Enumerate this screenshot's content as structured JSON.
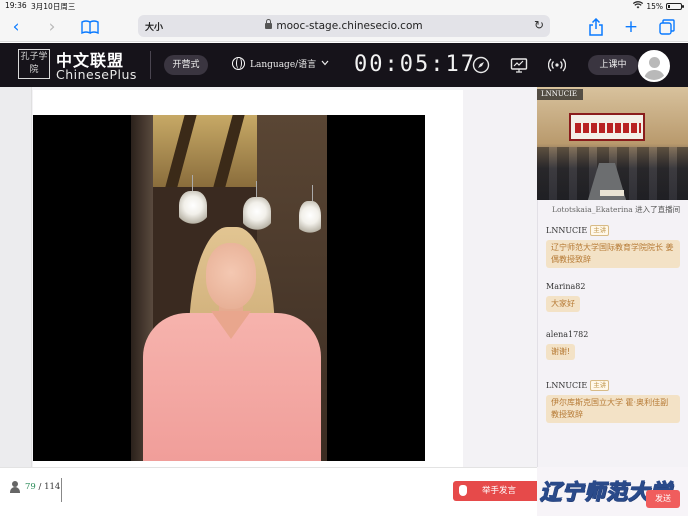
{
  "status_bar": {
    "time": "19:36",
    "date": "3月10日周三",
    "battery": "15%",
    "battery_level": 0.15
  },
  "browser": {
    "text_size": "大小",
    "url": "mooc-stage.chinesecio.com"
  },
  "header": {
    "logo_cn": "中文联盟",
    "logo_en": "ChinesePlus",
    "logo_seal": "孔子学院",
    "class_type": "开营式",
    "language": "Language/语言",
    "timer": "00:05:17",
    "status": "上课中",
    "icons": [
      "compass-icon",
      "screen-share-icon",
      "signal-icon"
    ]
  },
  "camera": {
    "badge": "LNNUCIE"
  },
  "chat": {
    "system": {
      "user": "Lototskaia_Ekaterina",
      "text": "进入了直播间"
    },
    "messages": [
      {
        "user": "LNNUCIE",
        "role": "主讲",
        "text": "辽宁师范大学国际教育学院院长 姜偶教授致辞"
      },
      {
        "user": "Marina82",
        "role": "",
        "text": "大家好"
      },
      {
        "user": "alena1782",
        "role": "",
        "text": "谢谢!"
      },
      {
        "user": "LNNUCIE",
        "role": "主讲",
        "text": "伊尔库斯克国立大学 霍·奥利佳副教授致辞"
      }
    ]
  },
  "footer": {
    "online_count": "79",
    "total_count": "114",
    "raise_hand": "举手发言",
    "send": "发送",
    "watermark": "辽宁师范大学"
  },
  "colors": {
    "accent_red": "#e64a4a",
    "header_bg": "#16131a",
    "bubble_bg": "#f3e2c6",
    "bubble_text": "#b67a35",
    "count_green": "#2c8c5a"
  }
}
